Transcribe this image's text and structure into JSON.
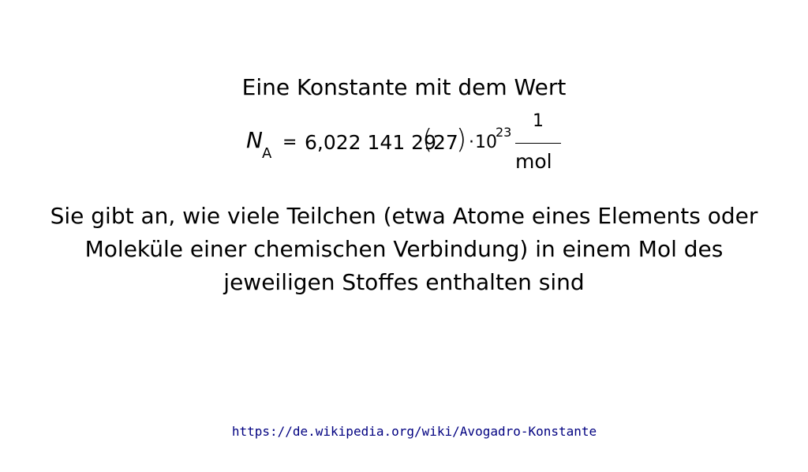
{
  "heading": "Eine Konstante mit dem Wert",
  "formula": {
    "symbol": "N",
    "subscript": "A",
    "equals": "=",
    "value": "6,022 141 29",
    "paren_open": "(",
    "uncertainty": "27",
    "paren_close": ")",
    "times": "·",
    "base": "10",
    "exponent": "23",
    "unit_numerator": "1",
    "unit_denominator": "mol"
  },
  "description": "Sie gibt an, wie viele Teilchen (etwa Atome eines Elements oder Moleküle einer chemischen Verbindung) in einem Mol des jeweiligen Stoffes enthalten sind",
  "source_url": "https://de.wikipedia.org/wiki/Avogadro-Konstante"
}
